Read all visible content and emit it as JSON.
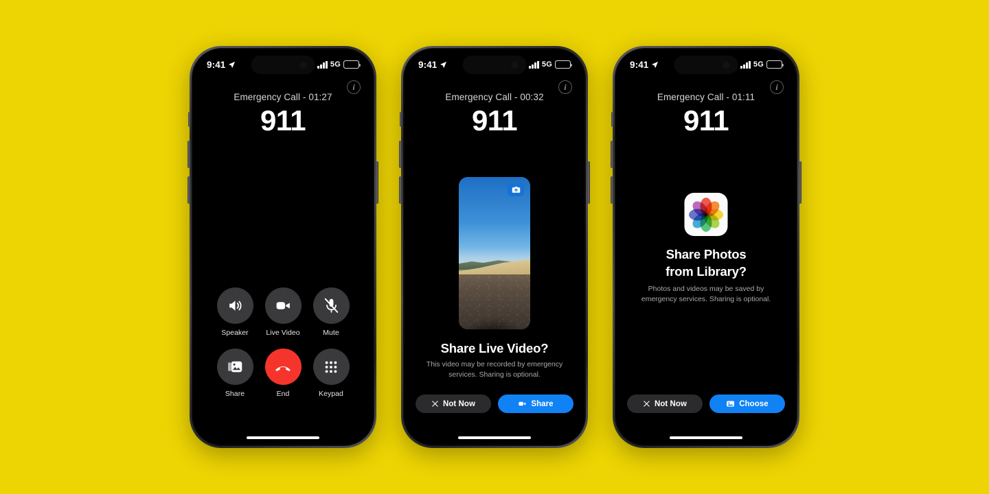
{
  "background_color": "#EDD403",
  "accent_blue": "#1082f5",
  "end_call_red": "#f5352b",
  "status_bar": {
    "time": "9:41",
    "location_icon": "location-arrow-icon",
    "signal_icon": "cellular-bars-icon",
    "network": "5G",
    "battery_icon": "battery-icon"
  },
  "phones": [
    {
      "id": "phone-call-controls",
      "info_button_label": "i",
      "call_status": "Emergency Call - 01:27",
      "call_number": "911",
      "controls": [
        {
          "label": "Speaker",
          "icon": "speaker-icon"
        },
        {
          "label": "Live Video",
          "icon": "video-camera-icon"
        },
        {
          "label": "Mute",
          "icon": "microphone-muted-icon"
        },
        {
          "label": "Share",
          "icon": "photos-stack-icon"
        },
        {
          "label": "End",
          "icon": "end-call-handset-icon"
        },
        {
          "label": "Keypad",
          "icon": "keypad-dots-icon"
        }
      ]
    },
    {
      "id": "phone-share-live-video",
      "info_button_label": "i",
      "call_status": "Emergency Call - 00:32",
      "call_number": "911",
      "media": {
        "type": "live-video-preview",
        "flip_camera_icon": "flip-camera-icon",
        "description": "Outdoor landscape: blue sky, distant hills, golden field, gravel foreground"
      },
      "sheet": {
        "title": "Share Live Video?",
        "subtitle": "This video may be recorded by emergency services. Sharing is optional.",
        "buttons": [
          {
            "label": "Not Now",
            "icon": "close-x-icon",
            "style": "secondary"
          },
          {
            "label": "Share",
            "icon": "video-camera-icon",
            "style": "primary"
          }
        ]
      }
    },
    {
      "id": "phone-share-photos",
      "info_button_label": "i",
      "call_status": "Emergency Call - 01:11",
      "call_number": "911",
      "app_icon": "photos-app-icon",
      "sheet": {
        "title_line1": "Share Photos",
        "title_line2": "from Library?",
        "subtitle": "Photos and videos may be saved by emergency services. Sharing is optional.",
        "buttons": [
          {
            "label": "Not Now",
            "icon": "close-x-icon",
            "style": "secondary"
          },
          {
            "label": "Choose",
            "icon": "photo-image-icon",
            "style": "primary"
          }
        ]
      }
    }
  ],
  "photos_icon_petal_colors": [
    "#ef4136",
    "#f58220",
    "#f7d417",
    "#a7cf3b",
    "#3fbf6e",
    "#2ea3d8",
    "#5664c4",
    "#b558b9"
  ]
}
